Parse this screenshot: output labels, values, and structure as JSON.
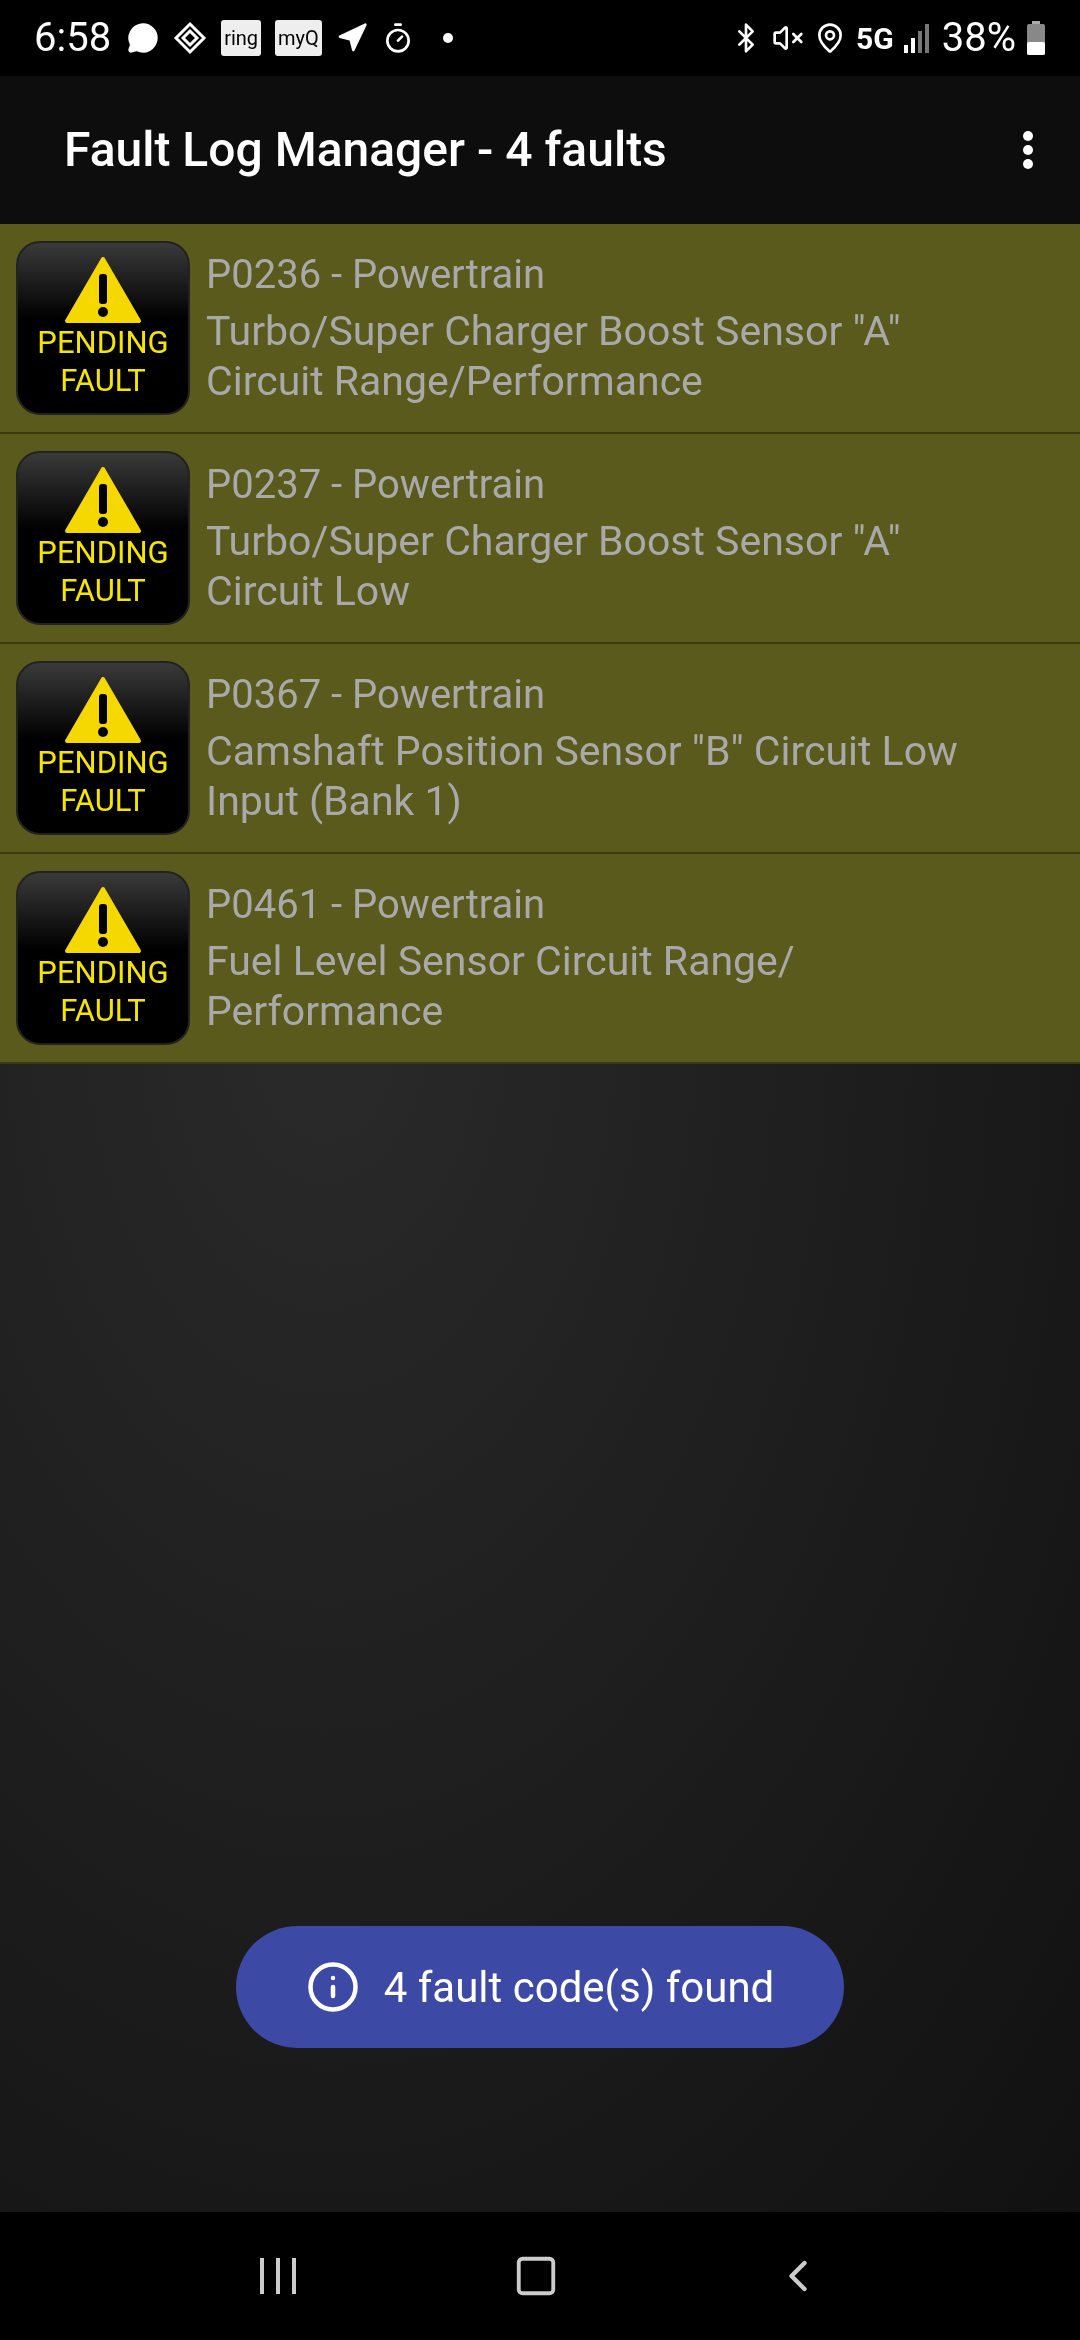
{
  "status_bar": {
    "time": "6:58",
    "app_badges": [
      "ring",
      "myQ"
    ],
    "network": "5G",
    "battery": "38%"
  },
  "app_bar": {
    "title": "Fault Log Manager - 4 faults"
  },
  "faults": [
    {
      "badge": [
        "PENDING",
        "FAULT"
      ],
      "code": "P0236 - Powertrain",
      "description": "Turbo/Super Charger Boost Sensor \"A\" Circuit Range/Performance"
    },
    {
      "badge": [
        "PENDING",
        "FAULT"
      ],
      "code": "P0237 - Powertrain",
      "description": "Turbo/Super Charger Boost Sensor \"A\" Circuit Low"
    },
    {
      "badge": [
        "PENDING",
        "FAULT"
      ],
      "code": "P0367 - Powertrain",
      "description": "Camshaft Position Sensor \"B\" Circuit Low Input (Bank 1)"
    },
    {
      "badge": [
        "PENDING",
        "FAULT"
      ],
      "code": "P0461 - Powertrain",
      "description": "Fuel Level Sensor Circuit Range/ Performance"
    }
  ],
  "toast": {
    "message": "4 fault code(s) found"
  }
}
